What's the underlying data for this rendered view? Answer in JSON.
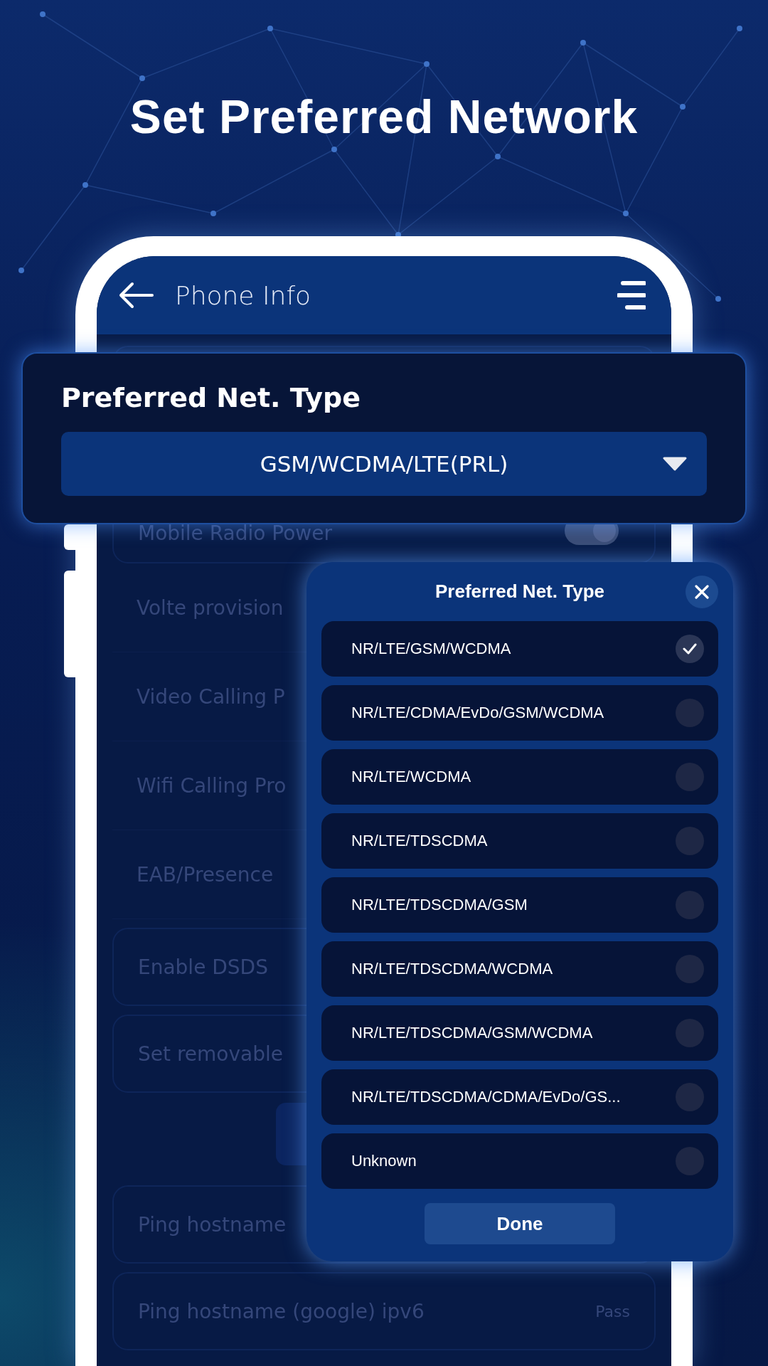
{
  "title": "Set Preferred Network",
  "phone": {
    "header": {
      "title": "Phone Info"
    },
    "rows": [
      {
        "kind": "toggle",
        "label": "Mobile Radio Power",
        "on": true
      },
      {
        "kind": "plain",
        "label": "Volte provision"
      },
      {
        "kind": "plain",
        "label": "Video Calling P"
      },
      {
        "kind": "plain",
        "label": "Wifi Calling Pro"
      },
      {
        "kind": "plain",
        "label": "EAB/Presence"
      },
      {
        "kind": "card",
        "label": "Enable DSDS"
      },
      {
        "kind": "card",
        "label": "Set removable"
      },
      {
        "kind": "button"
      },
      {
        "kind": "card",
        "label": "Ping hostname"
      },
      {
        "kind": "card",
        "label": "Ping hostname (google) ipv6",
        "value": "Pass"
      }
    ]
  },
  "callout": {
    "label": "Preferred Net. Type",
    "value": "GSM/WCDMA/LTE(PRL)"
  },
  "dialog": {
    "title": "Preferred Net. Type",
    "options": [
      {
        "label": "NR/LTE/GSM/WCDMA",
        "selected": true
      },
      {
        "label": "NR/LTE/CDMA/EvDo/GSM/WCDMA",
        "selected": false
      },
      {
        "label": "NR/LTE/WCDMA",
        "selected": false
      },
      {
        "label": "NR/LTE/TDSCDMA",
        "selected": false
      },
      {
        "label": "NR/LTE/TDSCDMA/GSM",
        "selected": false
      },
      {
        "label": "NR/LTE/TDSCDMA/WCDMA",
        "selected": false
      },
      {
        "label": "NR/LTE/TDSCDMA/GSM/WCDMA",
        "selected": false
      },
      {
        "label": "NR/LTE/TDSCDMA/CDMA/EvDo/GS...",
        "selected": false
      },
      {
        "label": "Unknown",
        "selected": false
      }
    ],
    "done": "Done"
  }
}
